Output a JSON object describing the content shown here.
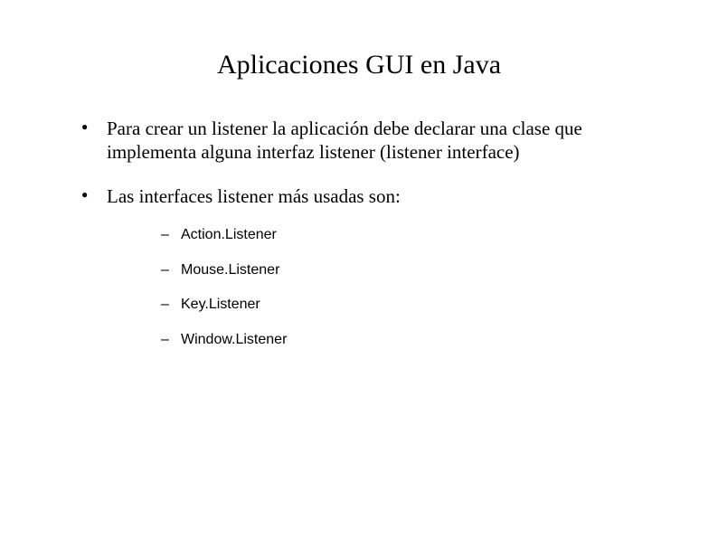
{
  "title": "Aplicaciones GUI en Java",
  "bullets": [
    {
      "text": "Para crear un listener la aplicación debe declarar una clase que implementa alguna interfaz listener (listener interface)"
    },
    {
      "text": "Las interfaces listener más usadas son:",
      "sub": [
        "Action.Listener",
        "Mouse.Listener",
        "Key.Listener",
        "Window.Listener"
      ]
    }
  ]
}
